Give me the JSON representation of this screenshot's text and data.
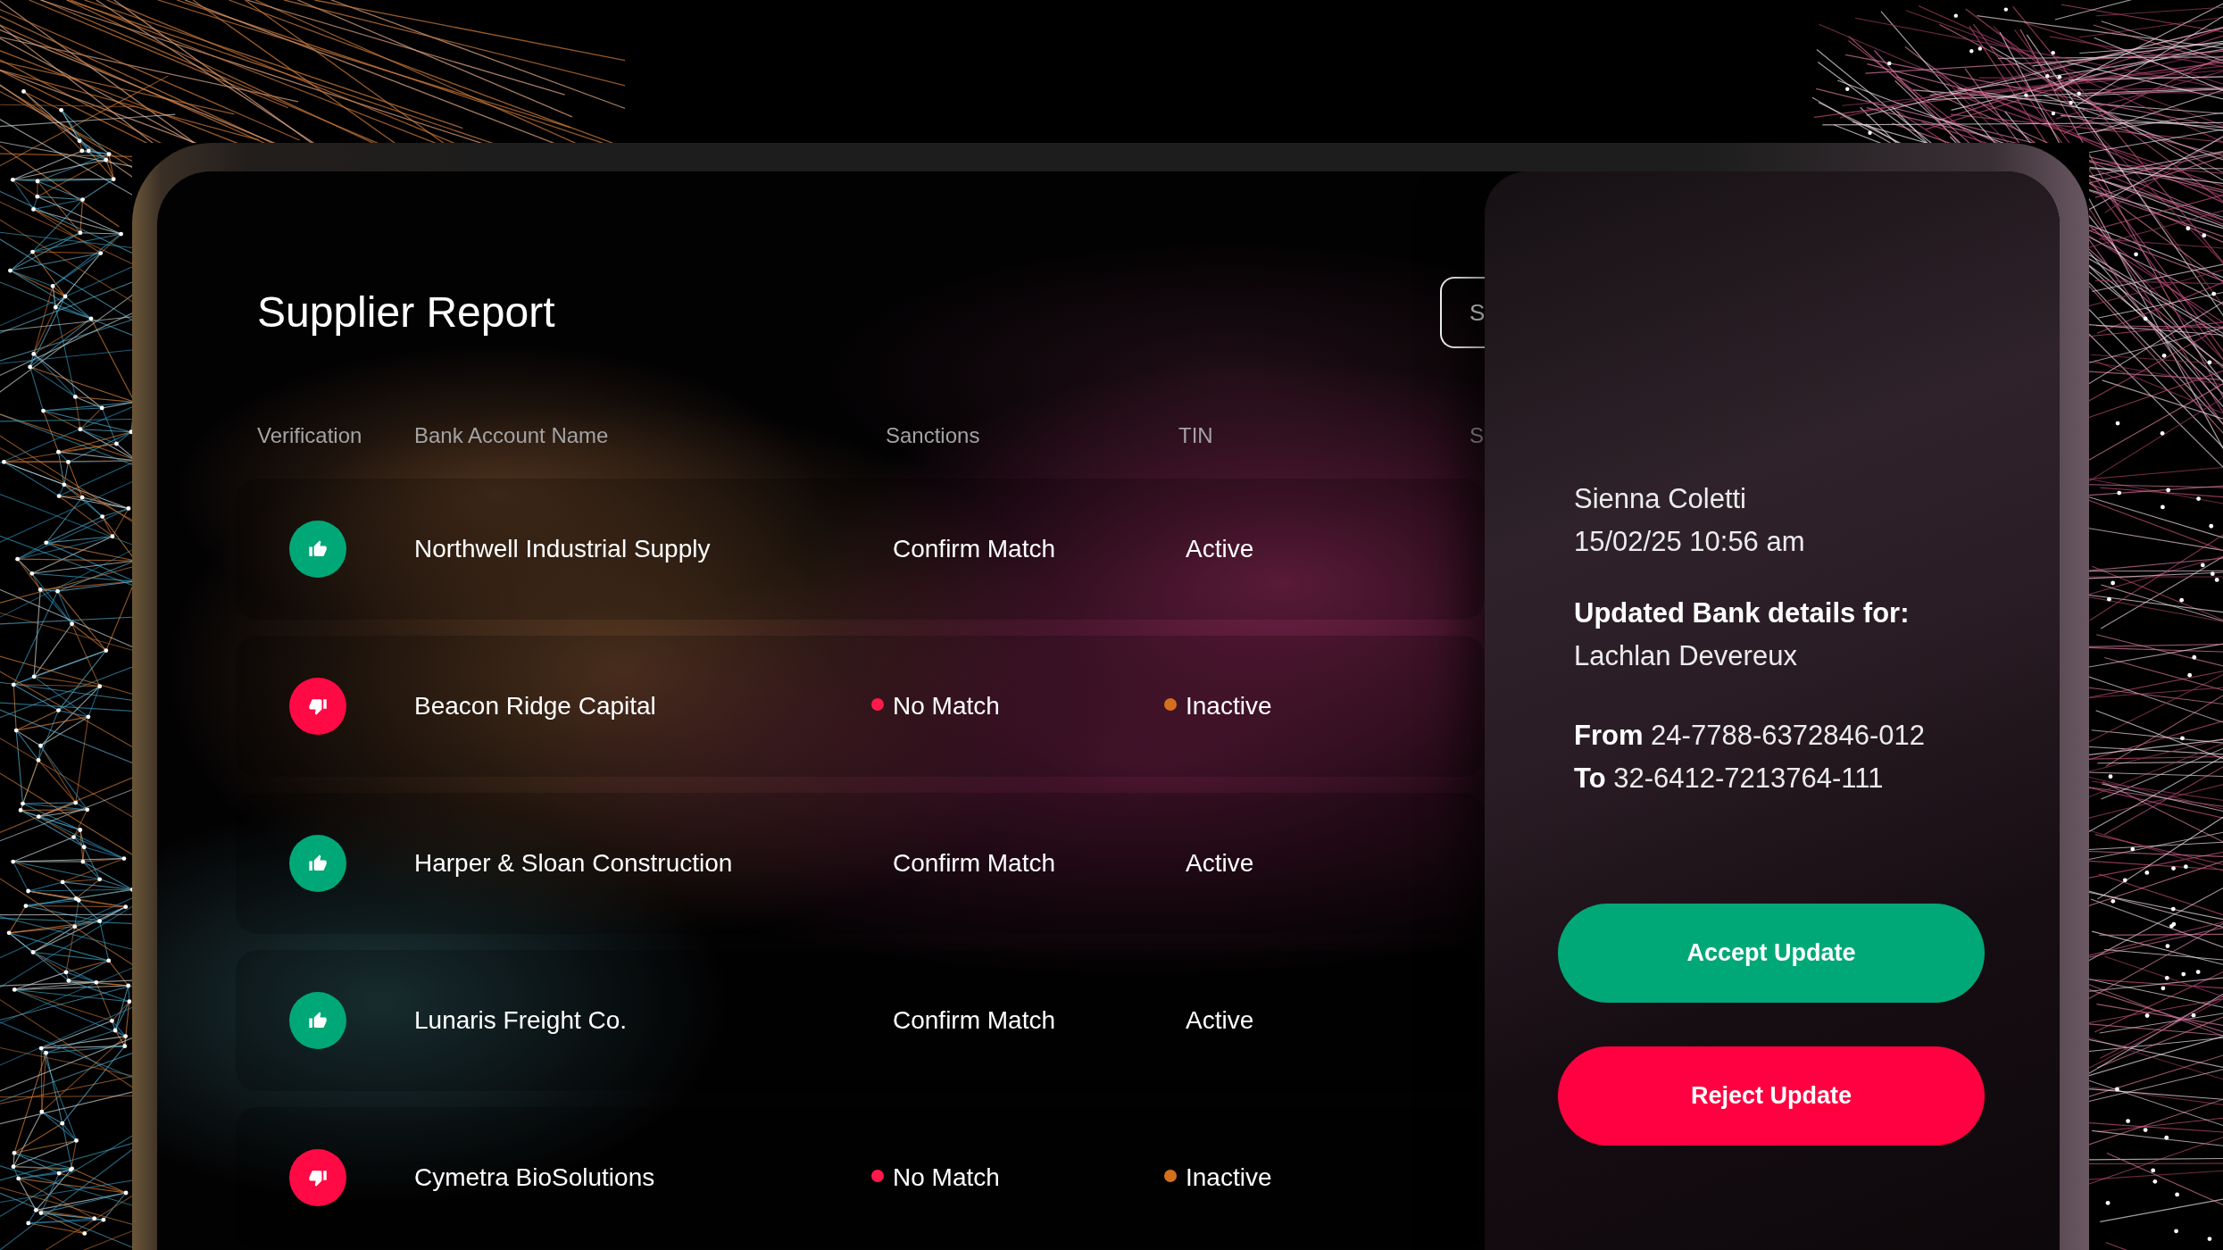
{
  "report": {
    "title": "Supplier Report",
    "action_button": {
      "label": "S"
    },
    "columns": [
      "Verification",
      "Bank Account Name",
      "Sanctions",
      "TIN",
      "S"
    ],
    "rows": [
      {
        "verified": true,
        "name": "Northwell Industrial Supply",
        "sanctions": {
          "text": "Confirm Match",
          "flagged": false
        },
        "tin": {
          "text": "Active",
          "flagged": false
        }
      },
      {
        "verified": false,
        "name": "Beacon Ridge Capital",
        "sanctions": {
          "text": "No Match",
          "flagged": true
        },
        "tin": {
          "text": "Inactive",
          "flagged": true
        }
      },
      {
        "verified": true,
        "name": "Harper & Sloan Construction",
        "sanctions": {
          "text": "Confirm Match",
          "flagged": false
        },
        "tin": {
          "text": "Active",
          "flagged": false
        }
      },
      {
        "verified": true,
        "name": "Lunaris Freight Co.",
        "sanctions": {
          "text": "Confirm Match",
          "flagged": false
        },
        "tin": {
          "text": "Active",
          "flagged": false
        }
      },
      {
        "verified": false,
        "name": "Cymetra BioSolutions",
        "sanctions": {
          "text": "No Match",
          "flagged": true
        },
        "tin": {
          "text": "Inactive",
          "flagged": true
        }
      }
    ]
  },
  "detail_panel": {
    "author": "Sienna Coletti",
    "timestamp": "15/02/25 10:56 am",
    "heading": "Updated Bank details for:",
    "subject": "Lachlan Devereux",
    "from": "**From** 24-7788-6372846-012",
    "to": "**To** 32-6412-7213764-111",
    "buttons": [
      {
        "label": "Accept Update",
        "kind": "accept"
      },
      {
        "label": "Reject Update",
        "kind": "reject"
      }
    ]
  }
}
